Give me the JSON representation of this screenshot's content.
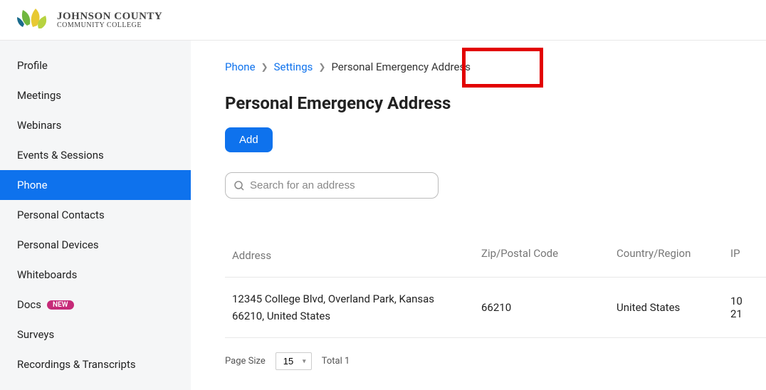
{
  "header": {
    "org_name_top": "JOHNSON COUNTY",
    "org_name_bottom": "COMMUNITY COLLEGE"
  },
  "sidebar": {
    "items": [
      {
        "label": "Profile"
      },
      {
        "label": "Meetings"
      },
      {
        "label": "Webinars"
      },
      {
        "label": "Events & Sessions"
      },
      {
        "label": "Phone"
      },
      {
        "label": "Personal Contacts"
      },
      {
        "label": "Personal Devices"
      },
      {
        "label": "Whiteboards"
      },
      {
        "label": "Docs",
        "badge": "NEW"
      },
      {
        "label": "Surveys"
      },
      {
        "label": "Recordings & Transcripts"
      }
    ]
  },
  "breadcrumb": {
    "item0": "Phone",
    "item1": "Settings",
    "current": "Personal Emergency Address"
  },
  "page": {
    "title": "Personal Emergency Address",
    "add_label": "Add"
  },
  "search": {
    "placeholder": "Search for an address"
  },
  "table": {
    "headers": {
      "address": "Address",
      "zip": "Zip/Postal Code",
      "country": "Country/Region",
      "ip": "IP"
    },
    "rows": [
      {
        "address": "12345 College Blvd, Overland Park, Kansas 66210, United States",
        "zip": "66210",
        "country": "United States",
        "ip_a": "10",
        "ip_b": "21"
      }
    ]
  },
  "pager": {
    "page_size_label": "Page Size",
    "page_size_value": "15",
    "total_label": "Total",
    "total_value": "1"
  }
}
